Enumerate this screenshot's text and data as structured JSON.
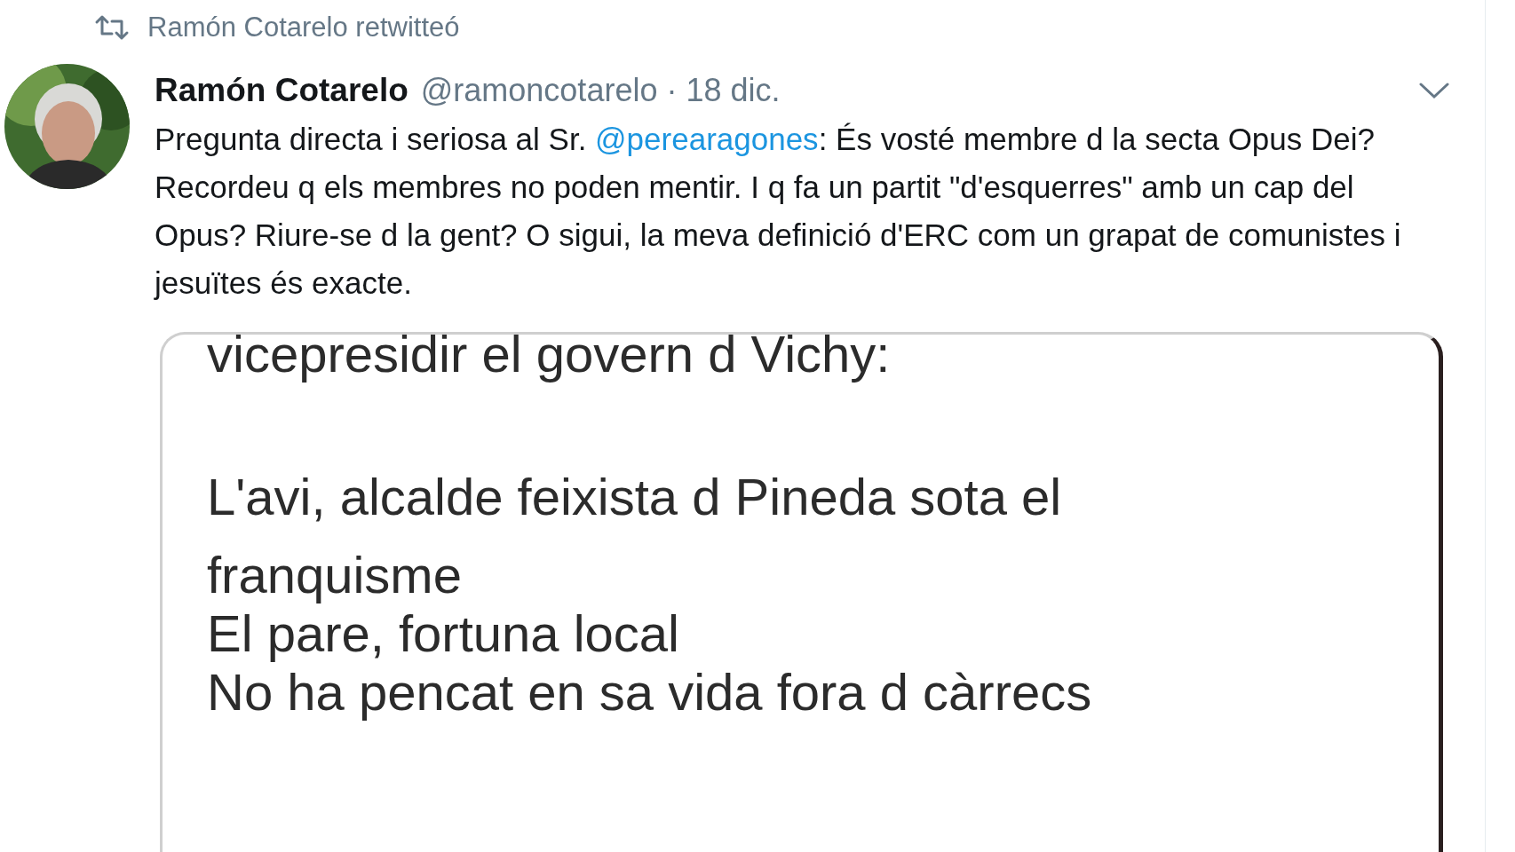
{
  "retweet_banner": {
    "text": "Ramón Cotarelo retwitteó"
  },
  "tweet": {
    "author": "Ramón Cotarelo",
    "handle": "@ramoncotarelo",
    "separator": "·",
    "date": "18 dic.",
    "body": [
      {
        "kind": "text",
        "text": "Pregunta directa i seriosa al Sr. "
      },
      {
        "kind": "mention",
        "text": "@perearagones"
      },
      {
        "kind": "text",
        "text": ": És vosté membre d la secta Opus Dei? Recordeu q els membres no poden mentir. I q fa un partit \"d'esquerres\" amb un cap del Opus? Riure-se d la gent? O sigui, la meva definició d'ERC com un grapat de comunistes i jesuïtes és exacte."
      }
    ],
    "image_text": [
      [
        "vicepresidir el govern d Vichy:"
      ],
      [
        "L'avi, alcalde feixista d Pineda sota el franquisme",
        "El pare, fortuna local",
        "No ha pencat en sa vida fora d càrrecs"
      ]
    ]
  }
}
